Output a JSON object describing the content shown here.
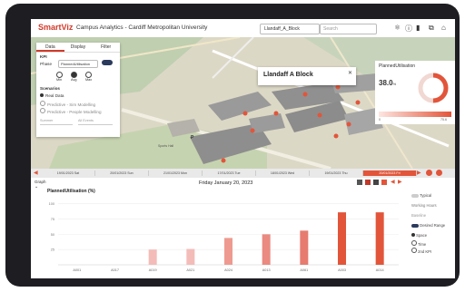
{
  "header": {
    "logo": "SmartViz",
    "app_title": "Campus Analytics - Cardiff Metropolitan University",
    "breadcrumb": "Llandaff_A_Block",
    "search_placeholder": "Search"
  },
  "data_panel": {
    "tabs": [
      "Data",
      "Display",
      "Filter"
    ],
    "section_label": "KPI",
    "phase_label": "Phase",
    "phase_value": "PlannedUtilisation",
    "radio_labels": [
      "Min",
      "Avg",
      "Max"
    ],
    "scenarios_label": "Scenarios",
    "scenarios": [
      "Real Data",
      "Predictive - Sim Modelling",
      "Predictive - People Modelling"
    ],
    "dropdowns": [
      "Summer",
      "All Events"
    ]
  },
  "map": {
    "popup_title": "Llandaff A Block",
    "parking_label": "P",
    "sports_label": "Sports Hall"
  },
  "gauge": {
    "title": "PlannedUtilisation",
    "value": "38.0",
    "unit": "%",
    "scale_min": "0",
    "scale_max": "75.6",
    "fill_fraction": 0.5
  },
  "timeline": {
    "dates": [
      "19/01/2023 Sat",
      "20/01/2023 Sun",
      "21/01/2023 Mon",
      "17/01/2023 Tue",
      "18/01/2023 Wed",
      "19/01/2023 Thu",
      "20/01/2023 Fri"
    ],
    "active_index": 6
  },
  "graph": {
    "label": "Graph",
    "date_title": "Friday January 20, 2023",
    "metric": "PlannedUtilisation (%)",
    "typical_label": "Typical",
    "working_hours_label": "Working Hours",
    "baseline_label": "Baseline",
    "desired_range_label": "Desired Range",
    "options": [
      "Space",
      "Time",
      "2nd KPI"
    ]
  },
  "chart_data": {
    "type": "bar",
    "categories": [
      "A001",
      "A017",
      "A019",
      "A021",
      "A024",
      "A013",
      "A061",
      "A003",
      "A014"
    ],
    "values": [
      0,
      0,
      25,
      26,
      44,
      50,
      56,
      86,
      86
    ],
    "yticks": [
      "100",
      "75",
      "50",
      "25"
    ],
    "ylim": [
      0,
      110
    ],
    "xlabel": "",
    "ylabel": "",
    "colors": [
      "#f4cccc",
      "#f4cccc",
      "#f3bcb8",
      "#f3bcb8",
      "#ee9a90",
      "#ea8a80",
      "#e77b70",
      "#e2553a",
      "#e2553a"
    ]
  }
}
